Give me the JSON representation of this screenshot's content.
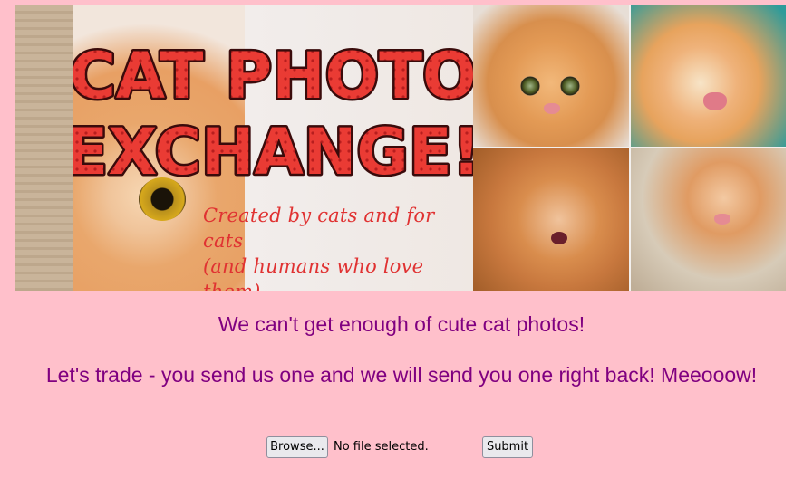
{
  "banner": {
    "title_line1": "CAT PHOTO",
    "title_line2": "EXCHANGE!",
    "tagline_line1": "Created by cats and for cats",
    "tagline_line2": "(and humans who love them)",
    "title_color": "#e83a33",
    "title_outline": "#5a0f0f"
  },
  "messages": {
    "line1": "We can't get enough of cute cat photos!",
    "line2": "Let's trade - you send us one and we will send you one right back! Meeooow!"
  },
  "form": {
    "browse_label": "Browse...",
    "file_status": "No file selected.",
    "submit_label": "Submit"
  },
  "colors": {
    "page_background": "#ffc0cb",
    "text": "#800080"
  }
}
